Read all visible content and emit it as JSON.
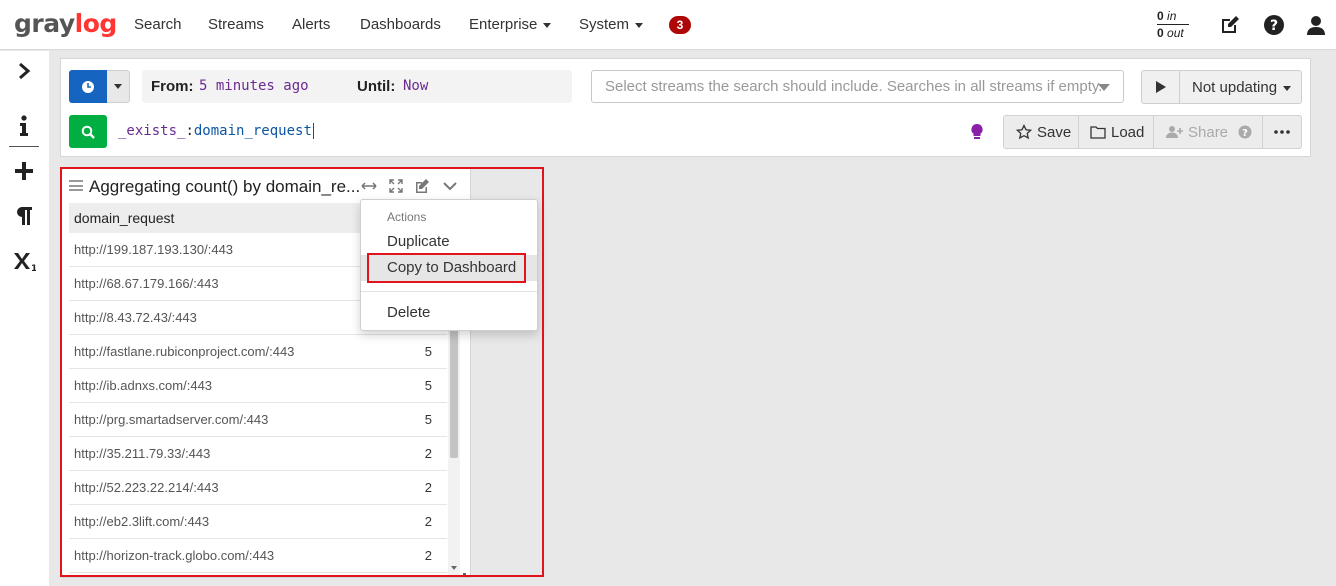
{
  "nav": {
    "logo_main": "gray",
    "logo_accent": "log",
    "items": [
      "Search",
      "Streams",
      "Alerts",
      "Dashboards"
    ],
    "dropdowns": [
      "Enterprise",
      "System"
    ],
    "notifications_count": "3",
    "throughput_in_value": "0",
    "throughput_in_unit": "in",
    "throughput_out_value": "0",
    "throughput_out_unit": "out"
  },
  "sidebar": {
    "icons": [
      "chevron-right-icon",
      "info-icon",
      "plus-icon",
      "paragraph-icon",
      "subscript-icon"
    ]
  },
  "search": {
    "from_label": "From",
    "from_value": "5 minutes ago",
    "until_label": "Until",
    "until_value": "Now",
    "streams_placeholder": "Select streams the search should include. Searches in all streams if empty.",
    "refresh_label": "Not updating",
    "query_field": "_exists_",
    "query_sep": ":",
    "query_value": "domain_request",
    "save_label": "Save",
    "load_label": "Load",
    "share_label": "Share"
  },
  "widget": {
    "title": "Aggregating count() by domain_re...",
    "column_header": "domain_request",
    "rows": [
      {
        "url": "http://199.187.193.130/:443",
        "count": ""
      },
      {
        "url": "http://68.67.179.166/:443",
        "count": ""
      },
      {
        "url": "http://8.43.72.43/:443",
        "count": ""
      },
      {
        "url": "http://fastlane.rubiconproject.com/:443",
        "count": "5"
      },
      {
        "url": "http://ib.adnxs.com/:443",
        "count": "5"
      },
      {
        "url": "http://prg.smartadserver.com/:443",
        "count": "5"
      },
      {
        "url": "http://35.211.79.33/:443",
        "count": "2"
      },
      {
        "url": "http://52.223.22.214/:443",
        "count": "2"
      },
      {
        "url": "http://eb2.3lift.com/:443",
        "count": "2"
      },
      {
        "url": "http://horizon-track.globo.com/:443",
        "count": "2"
      }
    ]
  },
  "actions_menu": {
    "header": "Actions",
    "items": [
      "Duplicate",
      "Copy to Dashboard",
      "Delete"
    ],
    "highlighted": "Copy to Dashboard"
  },
  "colors": {
    "brand_red": "#ff3633",
    "search_button_green": "#00ae42",
    "time_button_blue": "#1565c0",
    "annotation_red": "#e3131b",
    "query_purple": "#6a2a91",
    "query_blue": "#0d56a4"
  }
}
